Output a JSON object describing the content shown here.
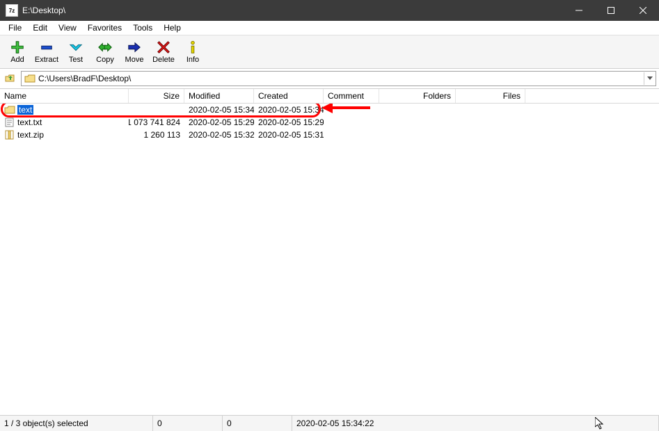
{
  "titlebar": {
    "title": "E:\\Desktop\\"
  },
  "menu": {
    "items": [
      "File",
      "Edit",
      "View",
      "Favorites",
      "Tools",
      "Help"
    ]
  },
  "toolbar": {
    "buttons": [
      {
        "key": "add",
        "label": "Add",
        "icon": "plus"
      },
      {
        "key": "extract",
        "label": "Extract",
        "icon": "minus"
      },
      {
        "key": "test",
        "label": "Test",
        "icon": "check"
      },
      {
        "key": "copy",
        "label": "Copy",
        "icon": "arrows"
      },
      {
        "key": "move",
        "label": "Move",
        "icon": "arrow-right"
      },
      {
        "key": "delete",
        "label": "Delete",
        "icon": "cross"
      },
      {
        "key": "info",
        "label": "Info",
        "icon": "info"
      }
    ]
  },
  "pathbar": {
    "path": "C:\\Users\\BradF\\Desktop\\"
  },
  "columns": [
    "Name",
    "Size",
    "Modified",
    "Created",
    "Comment",
    "Folders",
    "Files"
  ],
  "files": [
    {
      "name": "text",
      "type": "folder",
      "size": "",
      "modified": "2020-02-05 15:34",
      "created": "2020-02-05 15:34",
      "selected": true
    },
    {
      "name": "text.txt",
      "type": "txt",
      "size": "1 073 741 824",
      "modified": "2020-02-05 15:29",
      "created": "2020-02-05 15:29",
      "selected": false
    },
    {
      "name": "text.zip",
      "type": "zip",
      "size": "1 260 113",
      "modified": "2020-02-05 15:32",
      "created": "2020-02-05 15:31",
      "selected": false
    }
  ],
  "status": {
    "selection": "1 / 3 object(s) selected",
    "size1": "0",
    "size2": "0",
    "datetime": "2020-02-05 15:34:22"
  },
  "icons": {
    "plus": "#2fb52f",
    "minus": "#1651b8",
    "check": "#00a0cf",
    "arrows": "#1f9e3f",
    "arrow-right": "#12217c",
    "cross": "#d41111",
    "info": "#d9c600"
  }
}
